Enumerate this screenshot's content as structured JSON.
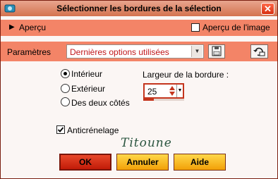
{
  "window": {
    "title": "Sélectionner les bordures de la sélection",
    "close_glyph": "✕"
  },
  "preview_bar": {
    "label": "Aperçu",
    "image_preview_label": "Aperçu de l'image",
    "image_preview_checked": false
  },
  "params": {
    "label": "Paramètres",
    "preset_value": "Dernières options utilisées"
  },
  "options": {
    "border_type": [
      {
        "label": "Intérieur",
        "selected": true
      },
      {
        "label": "Extérieur",
        "selected": false
      },
      {
        "label": "Des deux côtés",
        "selected": false
      }
    ],
    "border_width_label": "Largeur de la bordure :",
    "border_width_value": "25",
    "border_width_level": 0.25
  },
  "antialias": {
    "label": "Anticrénelage",
    "checked": true
  },
  "watermark": "Titoune",
  "buttons": {
    "ok": "OK",
    "cancel": "Annuler",
    "help": "Aide"
  },
  "colors": {
    "accent_bar": "#f38467",
    "title_gradient_bottom": "#d4734f",
    "ok_button": "#c11b08",
    "secondary_buttons": "#f2a007"
  },
  "icons": [
    "app-icon",
    "close-icon",
    "expand-arrow-icon",
    "save-preset-icon",
    "reset-defaults-icon",
    "dropdown-arrow-icon"
  ]
}
